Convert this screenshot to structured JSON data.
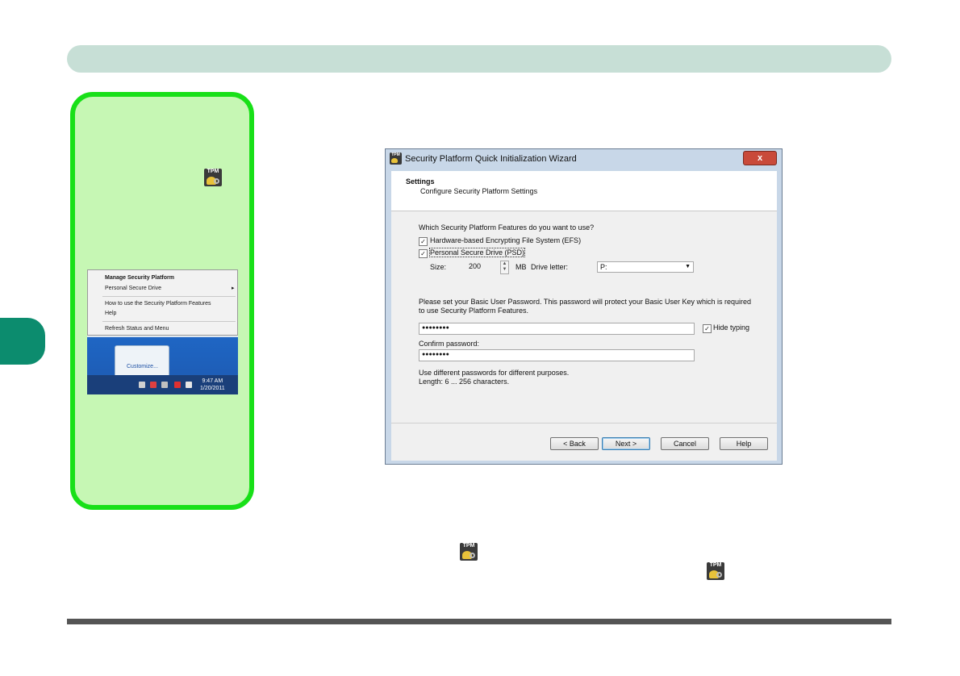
{
  "sidebar": {
    "tray_menu": {
      "items": [
        "Manage Security Platform",
        "Personal Secure Drive",
        "How to use the Security Platform Features",
        "Help",
        "Refresh Status and Menu"
      ],
      "customize": "Customize...",
      "clock_time": "9:47 AM",
      "clock_date": "1/20/2011"
    }
  },
  "wizard": {
    "title": "Security Platform Quick Initialization Wizard",
    "close_glyph": "x",
    "heading": "Settings",
    "subheading": "Configure Security Platform Settings",
    "question": "Which Security Platform Features do you want to use?",
    "efs_label": "Hardware-based Encrypting File System (EFS)",
    "psd_label": "Personal Secure Drive (PSD)",
    "size_label": "Size:",
    "size_value": "200",
    "mb_label": "MB",
    "drive_letter_label": "Drive letter:",
    "drive_letter_value": "P:",
    "password_intro_1": "Please set your Basic User Password. This password will protect your Basic User Key which is required",
    "password_intro_2": "to use Security Platform Features.",
    "password_value": "●●●●●●●●",
    "hide_typing_label": "Hide typing",
    "confirm_label": "Confirm password:",
    "confirm_value": "●●●●●●●●",
    "hint_1": "Use different passwords for different purposes.",
    "hint_2": "Length: 6 ... 256 characters.",
    "buttons": {
      "back": "< Back",
      "next": "Next >",
      "cancel": "Cancel",
      "help": "Help"
    }
  },
  "icons": {
    "tpm": "TPM"
  }
}
